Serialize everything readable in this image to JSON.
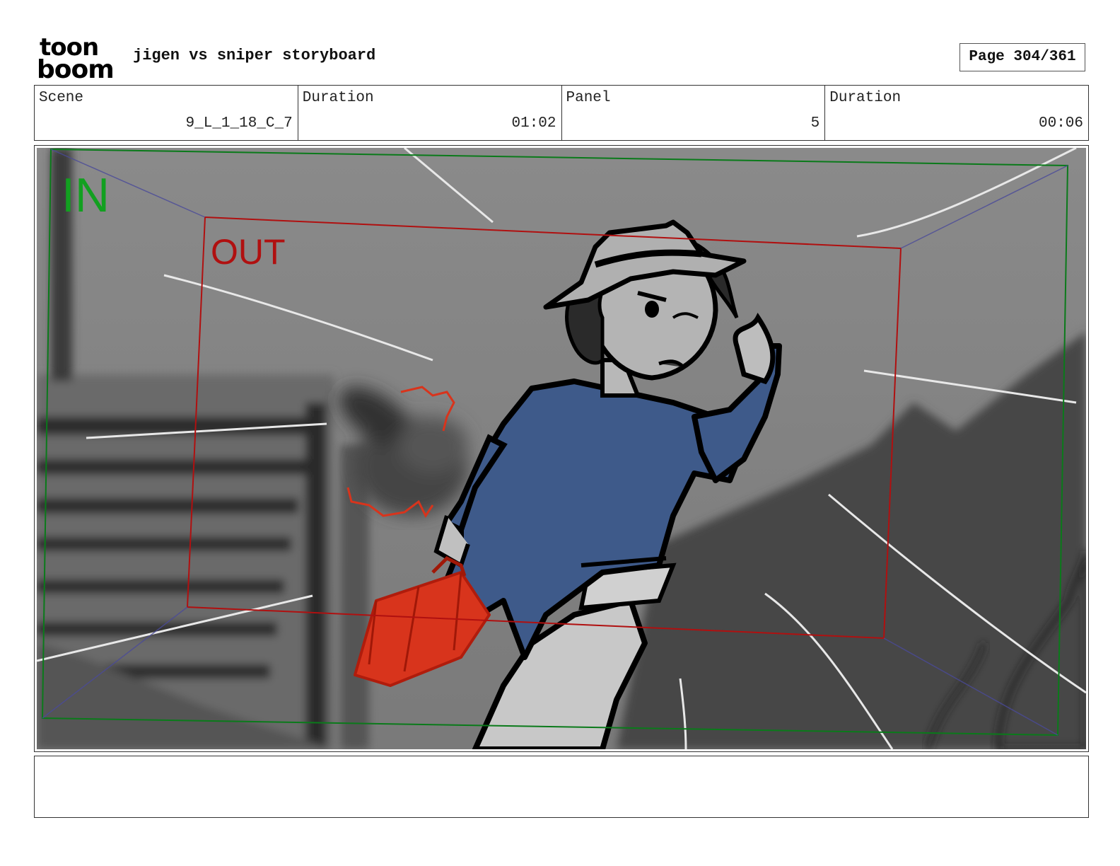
{
  "header": {
    "logo_line1": "toon",
    "logo_line2": "boom",
    "title": "jigen vs sniper storyboard",
    "page_label": "Page 304/361"
  },
  "info": {
    "scene_label": "Scene",
    "scene_value": "9_L_1_18_C_7",
    "scene_duration_label": "Duration",
    "scene_duration_value": "01:02",
    "panel_label": "Panel",
    "panel_value": "5",
    "panel_duration_label": "Duration",
    "panel_duration_value": "00:06"
  },
  "panel": {
    "in_label": "IN",
    "out_label": "OUT",
    "colors": {
      "in_frame": "#0a7a1a",
      "out_frame": "#b01010",
      "shirt": "#3e5a8a",
      "case": "#d8341c"
    }
  },
  "notes": {
    "text": ""
  }
}
